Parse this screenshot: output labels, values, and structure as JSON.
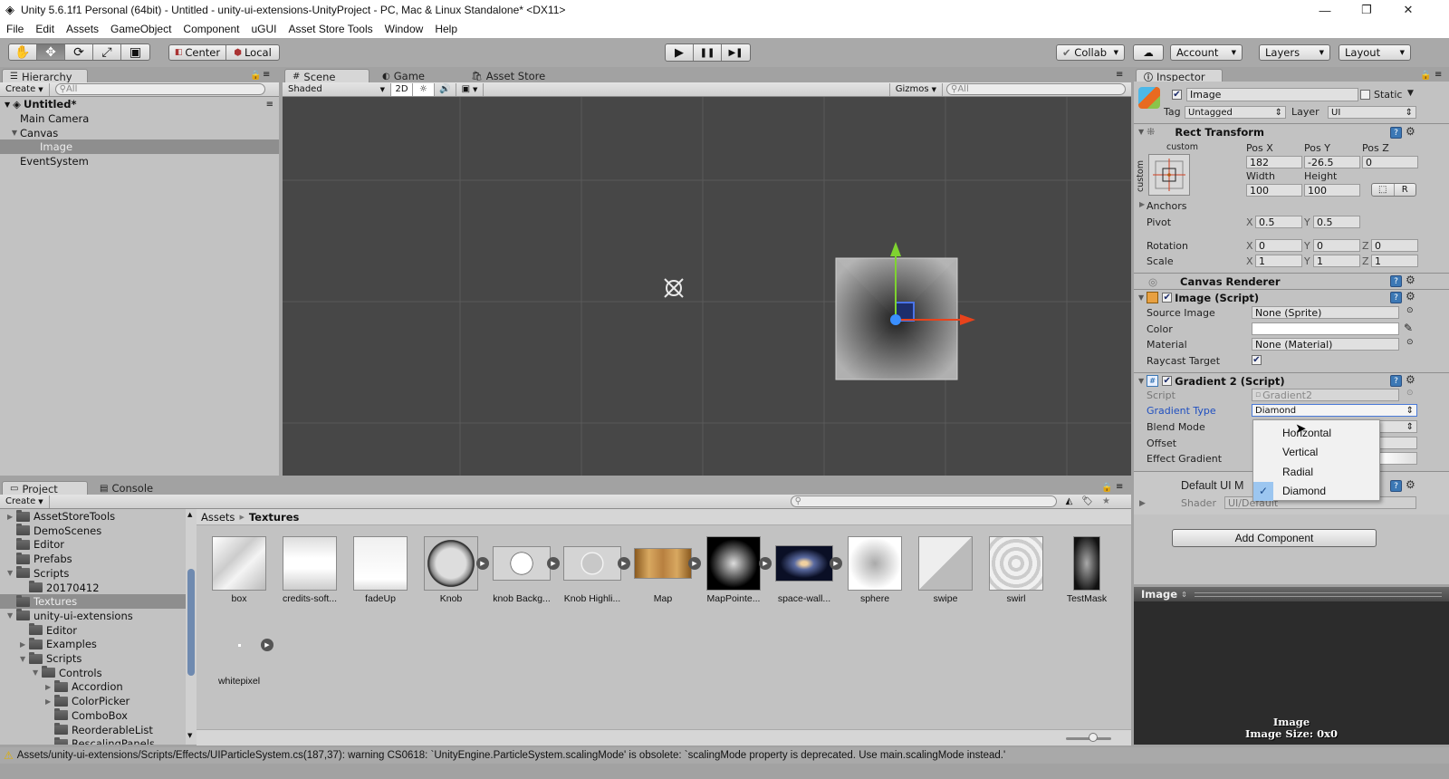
{
  "window": {
    "title": "Unity 5.6.1f1 Personal (64bit) - Untitled - unity-ui-extensions-UnityProject - PC, Mac & Linux Standalone* <DX11>",
    "controls": {
      "minimize": "—",
      "restore": "❐",
      "close": "✕"
    }
  },
  "menu": [
    "File",
    "Edit",
    "Assets",
    "GameObject",
    "Component",
    "uGUI",
    "Asset Store Tools",
    "Window",
    "Help"
  ],
  "toolbar": {
    "tools": [
      {
        "name": "hand-tool",
        "glyph": "✋"
      },
      {
        "name": "move-tool",
        "glyph": "✥"
      },
      {
        "name": "rotate-tool",
        "glyph": "⟳"
      },
      {
        "name": "scale-tool",
        "glyph": "⤢"
      },
      {
        "name": "rect-tool",
        "glyph": "▣"
      }
    ],
    "pivot": "Center",
    "space": "Local",
    "play": "▶",
    "pause": "❚❚",
    "step": "▶❚",
    "collab": "Collab",
    "cloud": "☁",
    "account": "Account",
    "layers": "Layers",
    "layout": "Layout"
  },
  "hierarchy": {
    "tab": "Hierarchy",
    "create": "Create",
    "search_placeholder": "All",
    "scene": "Untitled*",
    "items": [
      {
        "label": "Main Camera",
        "depth": 1,
        "expanded": null,
        "selected": false
      },
      {
        "label": "Canvas",
        "depth": 1,
        "expanded": true,
        "selected": false
      },
      {
        "label": "Image",
        "depth": 2,
        "expanded": null,
        "selected": true
      },
      {
        "label": "EventSystem",
        "depth": 1,
        "expanded": null,
        "selected": false
      }
    ]
  },
  "scene_view": {
    "tabs": [
      "Scene",
      "Game",
      "Asset Store"
    ],
    "active_tab": "Scene",
    "shading": "Shaded",
    "mode_2d": "2D",
    "gizmos": "Gizmos",
    "search_placeholder": "All"
  },
  "inspector": {
    "tab": "Inspector",
    "object_name": "Image",
    "active": true,
    "static_label": "Static",
    "static": false,
    "tag_label": "Tag",
    "tag": "Untagged",
    "layer_label": "Layer",
    "layer": "UI",
    "rect_transform": {
      "title": "Rect Transform",
      "anchor_preset": "custom",
      "pos_x_label": "Pos X",
      "pos_x": "182",
      "pos_y_label": "Pos Y",
      "pos_y": "-26.5",
      "pos_z_label": "Pos Z",
      "pos_z": "0",
      "width_label": "Width",
      "width": "100",
      "height_label": "Height",
      "height": "100",
      "raw_button": "R",
      "anchors_label": "Anchors",
      "pivot_label": "Pivot",
      "pivot_x": "0.5",
      "pivot_y": "0.5",
      "rotation_label": "Rotation",
      "rot_x": "0",
      "rot_y": "0",
      "rot_z": "0",
      "scale_label": "Scale",
      "scale_x": "1",
      "scale_y": "1",
      "scale_z": "1"
    },
    "canvas_renderer": {
      "title": "Canvas Renderer"
    },
    "image_script": {
      "title": "Image (Script)",
      "enabled": true,
      "source_image_label": "Source Image",
      "source_image": "None (Sprite)",
      "color_label": "Color",
      "color": "#ffffff",
      "material_label": "Material",
      "material": "None (Material)",
      "raycast_label": "Raycast Target",
      "raycast": true
    },
    "gradient_script": {
      "title": "Gradient 2 (Script)",
      "enabled": true,
      "script_label": "Script",
      "script": "Gradient2",
      "gradient_type_label": "Gradient Type",
      "gradient_type": "Diamond",
      "blend_mode_label": "Blend Mode",
      "offset_label": "Offset",
      "effect_gradient_label": "Effect Gradient"
    },
    "default_material": {
      "title": "Default UI M",
      "shader_label": "Shader",
      "shader": "UI/Default"
    },
    "add_component": "Add Component",
    "gradient_type_dropdown": {
      "options": [
        "Horizontal",
        "Vertical",
        "Radial",
        "Diamond"
      ],
      "selected": "Diamond"
    },
    "preview": {
      "title": "Image",
      "caption": "Image",
      "size": "Image Size: 0x0"
    }
  },
  "project": {
    "tabs": [
      "Project",
      "Console"
    ],
    "create": "Create",
    "tree": [
      {
        "label": "AssetStoreTools",
        "depth": 0,
        "arrow": "collapsed"
      },
      {
        "label": "DemoScenes",
        "depth": 0,
        "arrow": null
      },
      {
        "label": "Editor",
        "depth": 0,
        "arrow": null
      },
      {
        "label": "Prefabs",
        "depth": 0,
        "arrow": null
      },
      {
        "label": "Scripts",
        "depth": 0,
        "arrow": "expanded"
      },
      {
        "label": "20170412",
        "depth": 1,
        "arrow": null
      },
      {
        "label": "Textures",
        "depth": 0,
        "arrow": null,
        "selected": true
      },
      {
        "label": "unity-ui-extensions",
        "depth": 0,
        "arrow": "expanded"
      },
      {
        "label": "Editor",
        "depth": 1,
        "arrow": null
      },
      {
        "label": "Examples",
        "depth": 1,
        "arrow": "collapsed"
      },
      {
        "label": "Scripts",
        "depth": 1,
        "arrow": "expanded"
      },
      {
        "label": "Controls",
        "depth": 2,
        "arrow": "expanded"
      },
      {
        "label": "Accordion",
        "depth": 3,
        "arrow": "collapsed"
      },
      {
        "label": "ColorPicker",
        "depth": 3,
        "arrow": "collapsed"
      },
      {
        "label": "ComboBox",
        "depth": 3,
        "arrow": null
      },
      {
        "label": "ReorderableList",
        "depth": 3,
        "arrow": null
      },
      {
        "label": "RescalingPanels",
        "depth": 3,
        "arrow": null
      }
    ],
    "breadcrumb": [
      "Assets",
      "Textures"
    ],
    "assets": [
      {
        "label": "box",
        "kind": "box",
        "sub": false
      },
      {
        "label": "credits-soft...",
        "kind": "credits",
        "sub": false
      },
      {
        "label": "fadeUp",
        "kind": "fade",
        "sub": false
      },
      {
        "label": "Knob",
        "kind": "knob",
        "sub": true
      },
      {
        "label": "knob Backg...",
        "kind": "knobbg",
        "sub": true
      },
      {
        "label": "Knob Highli...",
        "kind": "knobhl",
        "sub": true
      },
      {
        "label": "Map",
        "kind": "map",
        "sub": true
      },
      {
        "label": "MapPointe...",
        "kind": "pointer",
        "sub": true
      },
      {
        "label": "space-wall...",
        "kind": "space",
        "sub": true
      },
      {
        "label": "sphere",
        "kind": "sphere",
        "sub": false
      },
      {
        "label": "swipe",
        "kind": "swipe",
        "sub": false
      },
      {
        "label": "swirl",
        "kind": "swirl",
        "sub": false
      },
      {
        "label": "TestMask",
        "kind": "mask",
        "sub": false
      },
      {
        "label": "whitepixel",
        "kind": "pixel",
        "sub": true
      }
    ]
  },
  "status": {
    "icon": "warning-icon",
    "message": "Assets/unity-ui-extensions/Scripts/Effects/UIParticleSystem.cs(187,37): warning CS0618: `UnityEngine.ParticleSystem.scalingMode' is obsolete: `scalingMode property is deprecated. Use main.scalingMode instead.'"
  }
}
